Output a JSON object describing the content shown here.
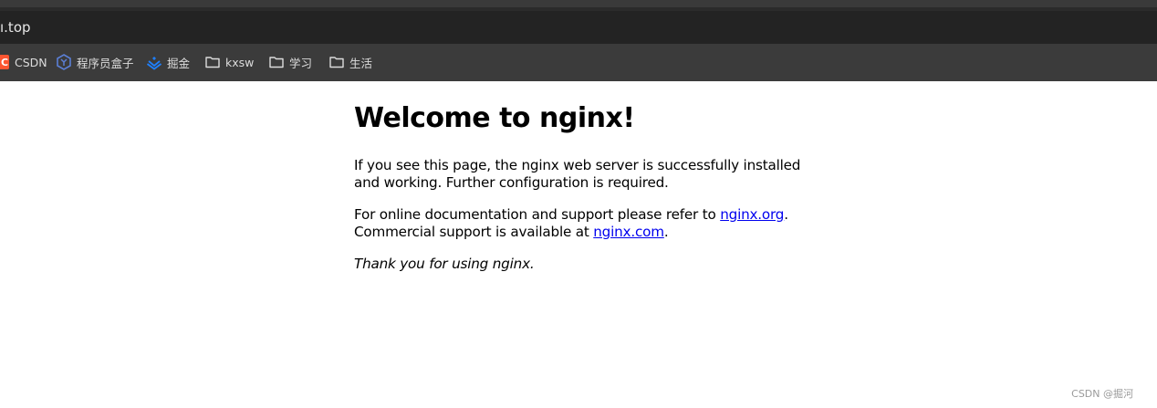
{
  "browser": {
    "address_bar": {
      "url_text": "ı.top"
    },
    "bookmarks": [
      {
        "label": "CSDN",
        "icon": "csdn-icon"
      },
      {
        "label": "程序员盒子",
        "icon": "hexagon-y-icon"
      },
      {
        "label": "掘金",
        "icon": "juejin-icon"
      },
      {
        "label": "kxsw",
        "icon": "folder-icon"
      },
      {
        "label": "学习",
        "icon": "folder-icon"
      },
      {
        "label": "生活",
        "icon": "folder-icon"
      }
    ]
  },
  "page": {
    "heading": "Welcome to nginx!",
    "para1": "If you see this page, the nginx web server is successfully installed and working. Further configuration is required.",
    "para2_before_link1": "For online documentation and support please refer to ",
    "link1": "nginx.org",
    "para2_between": ". Commercial support is available at ",
    "link2": "nginx.com",
    "para2_after": ".",
    "thanks": "Thank you for using nginx."
  },
  "watermark": "CSDN @掘河",
  "colors": {
    "link": "#0000ee",
    "csdn_brand": "#fc5531",
    "juejin_brand": "#1e80ff"
  }
}
